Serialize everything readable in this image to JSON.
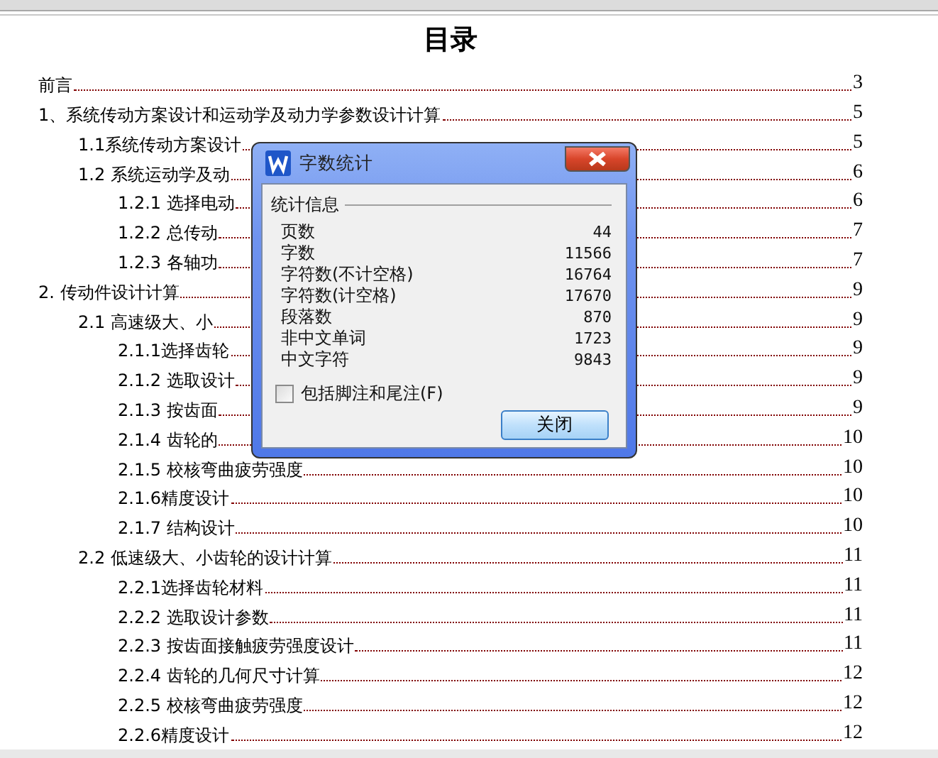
{
  "document": {
    "title": "目录",
    "toc": [
      {
        "text": "前言",
        "page": "3"
      },
      {
        "text": "1、系统传动方案设计和运动学及动力学参数设计计算",
        "page": "5",
        "children": [
          {
            "text": "1.1系统传动方案设计",
            "page": "5"
          },
          {
            "text": "1.2 系统运动学及动",
            "page": "6",
            "children": [
              {
                "text": "1.2.1 选择电动",
                "page": "6"
              },
              {
                "text": "1.2.2 总传动",
                "page": "7"
              },
              {
                "text": "1.2.3 各轴功",
                "page": "7"
              }
            ]
          }
        ]
      },
      {
        "text": "2. 传动件设计计算",
        "page": "9",
        "children": [
          {
            "text": "2.1 高速级大、小",
            "page": "9",
            "children": [
              {
                "text": "2.1.1选择齿轮",
                "page": "9"
              },
              {
                "text": "2.1.2 选取设计",
                "page": "9"
              },
              {
                "text": "2.1.3 按齿面",
                "page": "9"
              },
              {
                "text": "2.1.4 齿轮的",
                "page": "10"
              },
              {
                "text": "2.1.5 校核弯曲疲劳强度",
                "page": "10"
              },
              {
                "text": "2.1.6精度设计",
                "page": "10"
              },
              {
                "text": "2.1.7 结构设计",
                "page": "10"
              }
            ]
          },
          {
            "text": "2.2 低速级大、小齿轮的设计计算",
            "page": "11",
            "children": [
              {
                "text": "2.2.1选择齿轮材料",
                "page": "11"
              },
              {
                "text": "2.2.2 选取设计参数",
                "page": "11"
              },
              {
                "text": "2.2.3 按齿面接触疲劳强度设计",
                "page": "11"
              },
              {
                "text": "2.2.4 齿轮的几何尺寸计算",
                "page": "12"
              },
              {
                "text": "2.2.5 校核弯曲疲劳强度",
                "page": "12"
              },
              {
                "text": "2.2.6精度设计",
                "page": "12"
              }
            ]
          }
        ]
      }
    ]
  },
  "dialog": {
    "title": "字数统计",
    "group_label": "统计信息",
    "stats": [
      {
        "label": "页数",
        "value": "44"
      },
      {
        "label": "字数",
        "value": "11566"
      },
      {
        "label": "字符数(不计空格)",
        "value": "16764"
      },
      {
        "label": "字符数(计空格)",
        "value": "17670"
      },
      {
        "label": "段落数",
        "value": "870"
      },
      {
        "label": "非中文单词",
        "value": "1723"
      },
      {
        "label": "中文字符",
        "value": "9843"
      }
    ],
    "include_footnotes": {
      "label": "包括脚注和尾注(F)",
      "checked": false
    },
    "close_button": "关闭"
  }
}
